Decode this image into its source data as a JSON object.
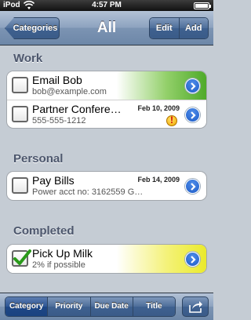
{
  "status_bar": {
    "carrier": "iPod",
    "time": "4:57 PM"
  },
  "nav": {
    "back_label": "Categories",
    "title": "All",
    "edit_label": "Edit",
    "add_label": "Add"
  },
  "sections": [
    {
      "header": "Work",
      "rows": [
        {
          "title": "Email Bob",
          "subtitle": "bob@example.com",
          "date": "",
          "checked": false,
          "highlight": "green",
          "priority_icon": false
        },
        {
          "title": "Partner Confere…",
          "subtitle": "555-555-1212",
          "date": "Feb 10, 2009",
          "checked": false,
          "highlight": "none",
          "priority_icon": true
        }
      ]
    },
    {
      "header": "Personal",
      "rows": [
        {
          "title": "Pay Bills",
          "subtitle": "Power acct no: 3162559 G…",
          "date": "Feb 14, 2009",
          "checked": false,
          "highlight": "none",
          "priority_icon": false
        }
      ]
    },
    {
      "header": "Completed",
      "rows": [
        {
          "title": "Pick Up Milk",
          "subtitle": "2% if possible",
          "date": "",
          "checked": true,
          "highlight": "yellow",
          "priority_icon": false
        }
      ]
    }
  ],
  "toolbar": {
    "sort_options": [
      "Category",
      "Priority",
      "Due Date",
      "Title"
    ],
    "selected_sort": "Category",
    "action_icon": "share-arrow-icon"
  },
  "colors": {
    "nav_blue": "#6d87a8",
    "disclosure_blue": "#1f5dc8",
    "highlight_green": "#4faa2a",
    "highlight_yellow": "#eaea2c",
    "section_text": "#4c566c"
  }
}
